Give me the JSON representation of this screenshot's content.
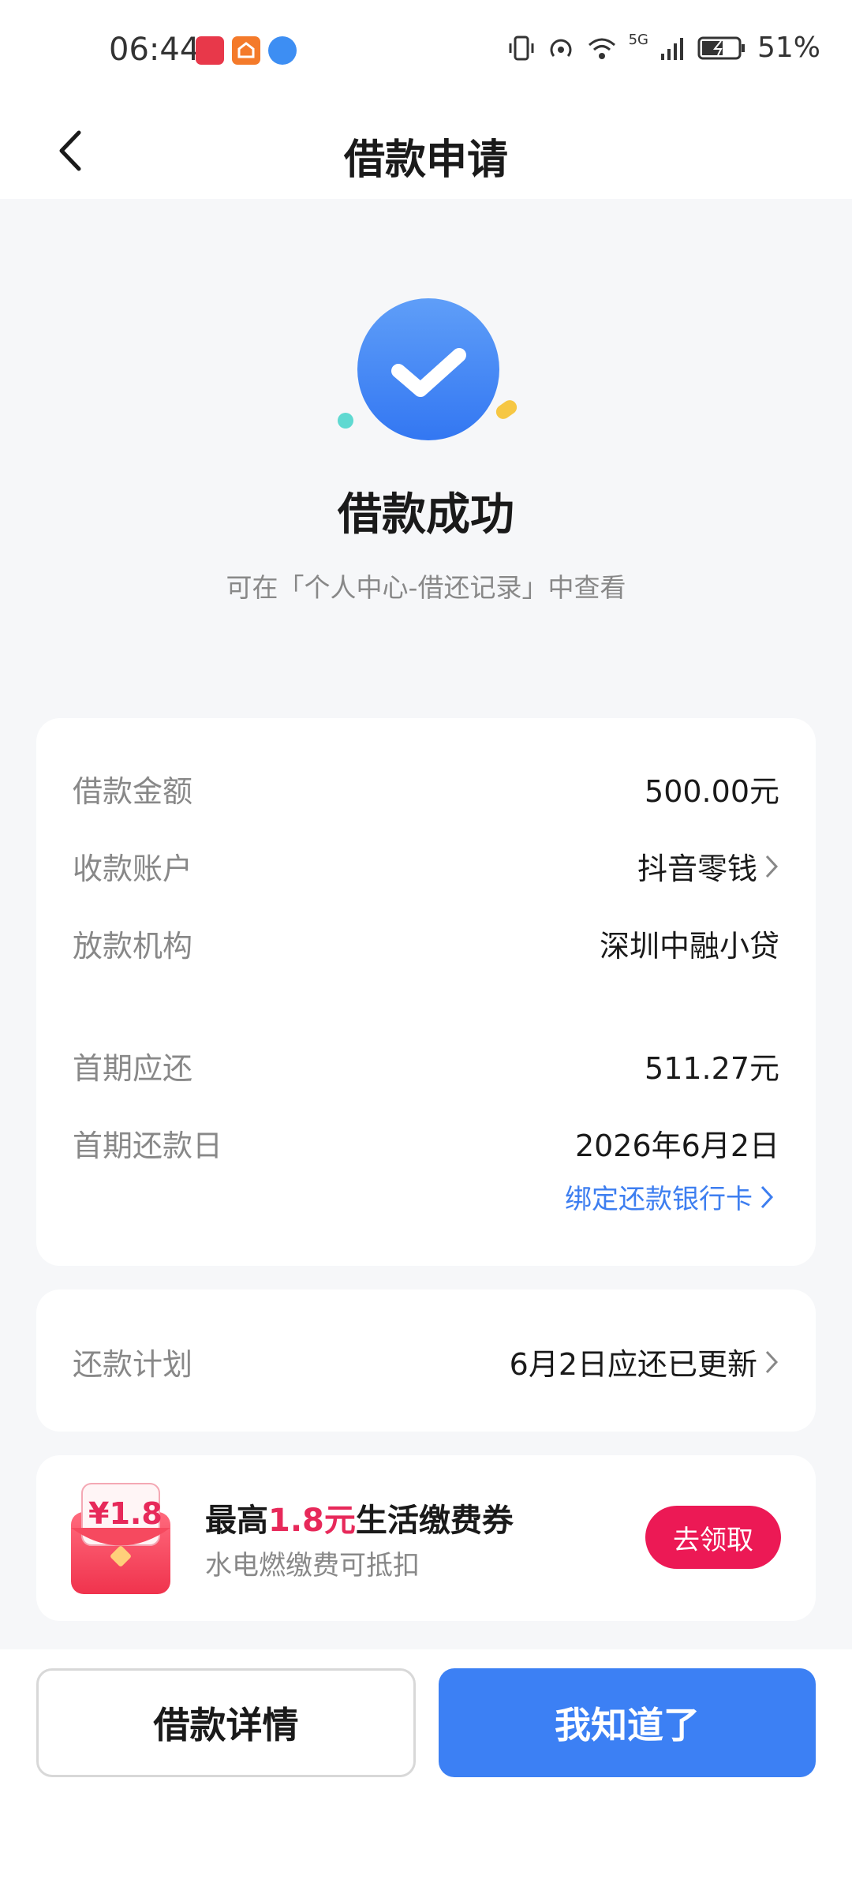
{
  "status_bar": {
    "time": "06:44",
    "battery": "51%",
    "network": "5G",
    "icons": [
      "vibrate-icon",
      "hotspot-icon",
      "wifi-icon",
      "signal-icon",
      "battery-charging-icon"
    ],
    "app_icons": [
      "huawei-appgallery-icon",
      "home-app-icon",
      "browser-icon"
    ]
  },
  "nav": {
    "title": "借款申请"
  },
  "success": {
    "title": "借款成功",
    "subtitle": "可在「个人中心-借还记录」中查看"
  },
  "details": {
    "loan_amount_label": "借款金额",
    "loan_amount_value": "500.00元",
    "account_label": "收款账户",
    "account_value": "抖音零钱",
    "lender_label": "放款机构",
    "lender_value": "深圳中融小贷",
    "first_due_label": "首期应还",
    "first_due_value": "511.27元",
    "first_date_label": "首期还款日",
    "first_date_value": "2026年6月2日",
    "bind_card_link": "绑定还款银行卡"
  },
  "plan": {
    "label": "还款计划",
    "value": "6月2日应还已更新"
  },
  "coupon": {
    "badge": "¥1.8",
    "title_prefix": "最高",
    "title_highlight": "1.8元",
    "title_suffix": "生活缴费券",
    "subtitle": "水电燃缴费可抵扣",
    "button": "去领取"
  },
  "buttons": {
    "details": "借款详情",
    "ok": "我知道了"
  },
  "colors": {
    "primary_blue": "#3c80f4",
    "link_blue": "#3d7ef0",
    "accent_red": "#ec1955",
    "background": "#f6f7f9"
  }
}
